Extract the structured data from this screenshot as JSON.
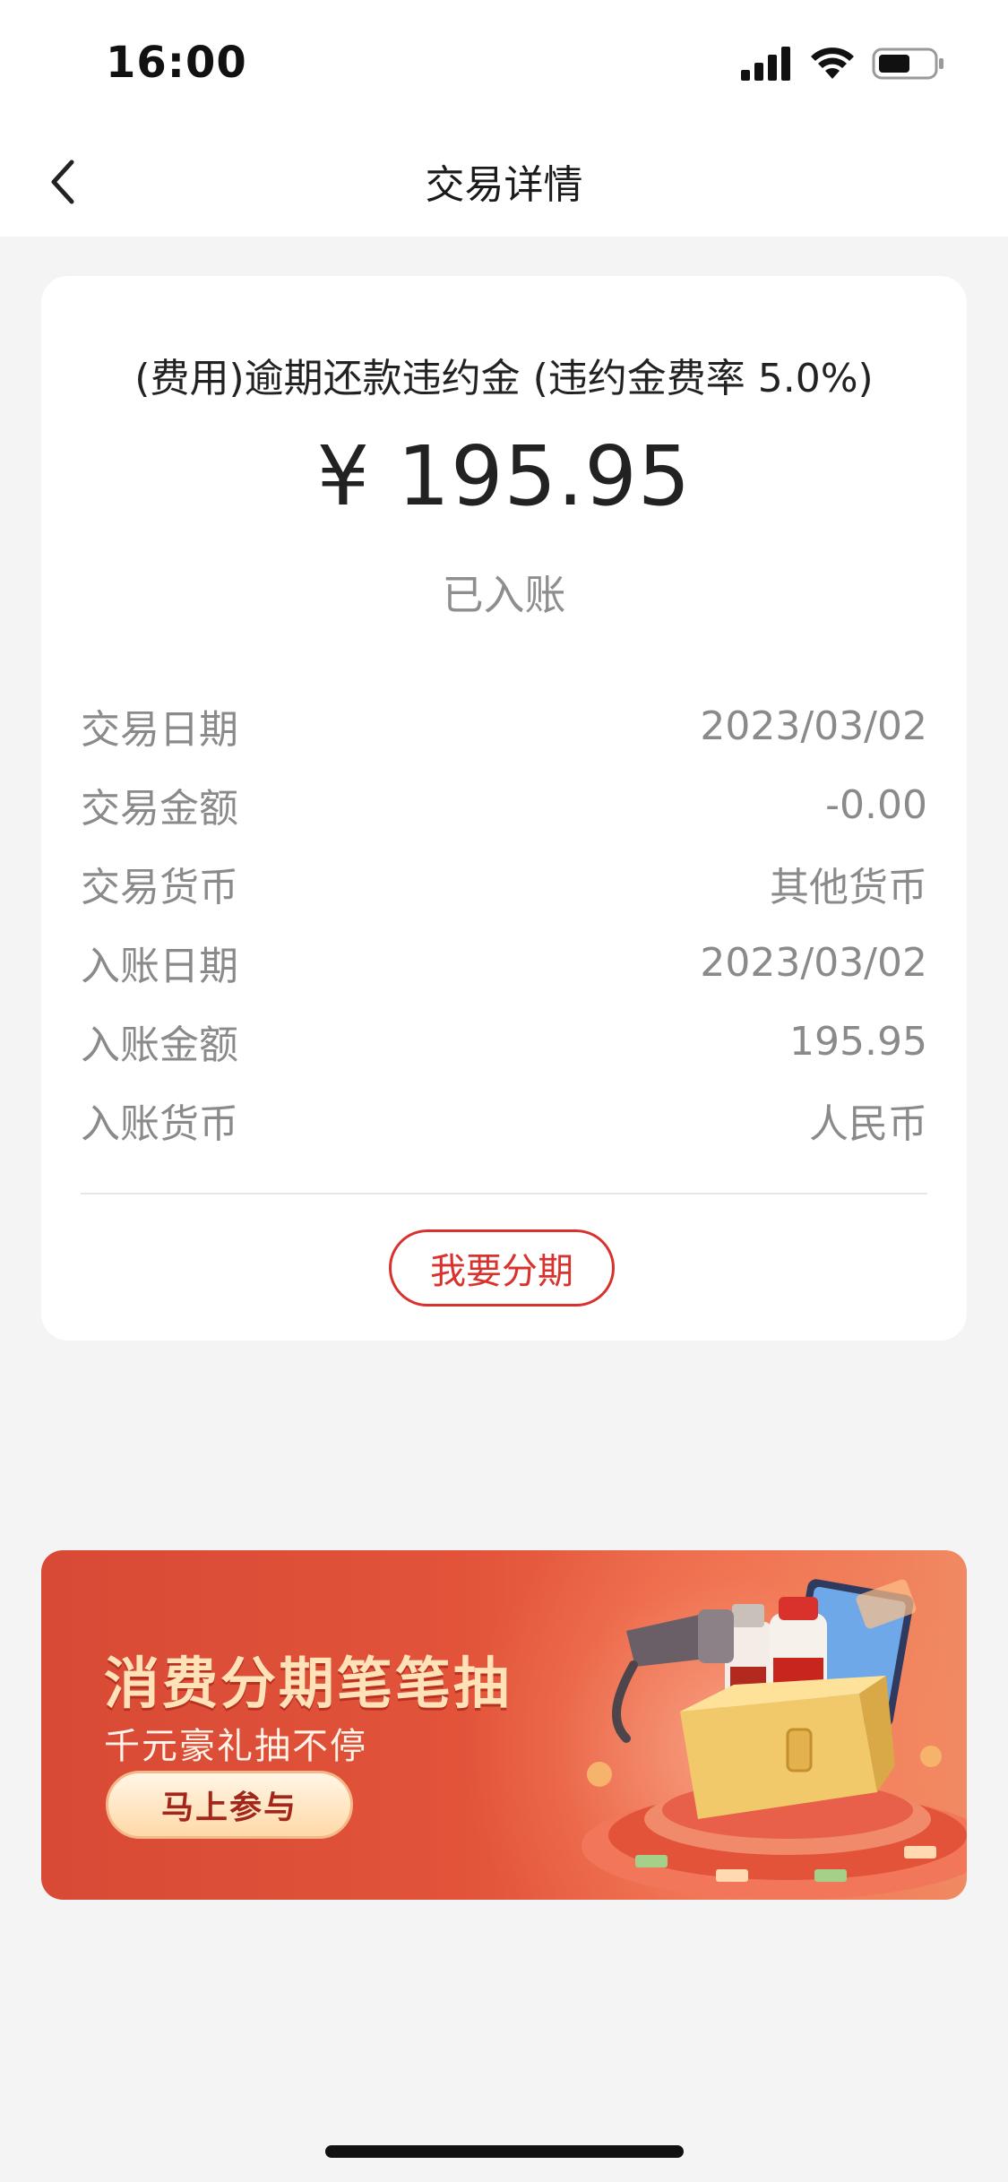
{
  "status_bar": {
    "time": "16:00",
    "icons": [
      "cellular-signal-icon",
      "wifi-icon",
      "battery-icon"
    ]
  },
  "nav": {
    "back_icon": "chevron-left-icon",
    "title": "交易详情"
  },
  "transaction": {
    "title": "(费用)逾期还款违约金 (违约金费率 5.0%)",
    "amount": "¥ 195.95",
    "status": "已入账",
    "details": [
      {
        "label": "交易日期",
        "value": "2023/03/02"
      },
      {
        "label": "交易金额",
        "value": "-0.00"
      },
      {
        "label": "交易货币",
        "value": "其他货币"
      },
      {
        "label": "入账日期",
        "value": "2023/03/02"
      },
      {
        "label": "入账金额",
        "value": "195.95"
      },
      {
        "label": "入账货币",
        "value": "人民币"
      }
    ],
    "installment_button": "我要分期"
  },
  "promo": {
    "headline": "消费分期笔笔抽",
    "subline": "千元豪礼抽不停",
    "cta": "马上参与"
  },
  "colors": {
    "accent_red": "#d9322d",
    "banner_red": "#e2533a",
    "page_bg": "#f4f4f4"
  }
}
